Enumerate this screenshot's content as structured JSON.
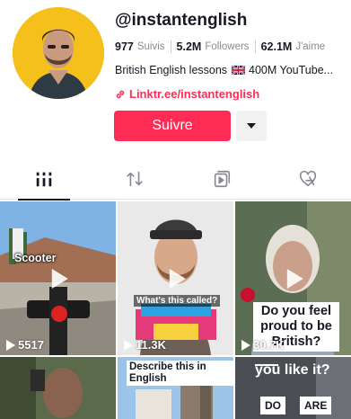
{
  "profile": {
    "username": "@instantenglish",
    "stats": [
      {
        "value": "977",
        "label": "Suivis"
      },
      {
        "value": "5.2M",
        "label": "Followers"
      },
      {
        "value": "62.1M",
        "label": "J'aime"
      }
    ],
    "bio_before_flag": "British English lessons",
    "bio_after_flag": " 400M YouTube...",
    "link": "Linktr.ee/instantenglish",
    "follow_label": "Suivre"
  },
  "tabs": [
    {
      "icon": "videos-grid-icon",
      "active": true
    },
    {
      "icon": "repost-icon",
      "active": false
    },
    {
      "icon": "playlist-icon",
      "active": false
    },
    {
      "icon": "liked-hidden-icon",
      "active": false
    }
  ],
  "videos": [
    {
      "overlay": "Scooter",
      "views": "5517"
    },
    {
      "overlay": "What's this called?",
      "views": "11.3K"
    },
    {
      "overlay": "Do you feel proud to be British?",
      "views": "30.7K"
    },
    {
      "overlay": "",
      "views": ""
    },
    {
      "overlay": "Describe this in English",
      "views": ""
    },
    {
      "overlay": "you like it?",
      "overlay_do": "DO",
      "overlay_are": "ARE",
      "views": ""
    }
  ],
  "colors": {
    "accent": "#fe2c55",
    "avatar_bg": "#f5c01c"
  }
}
